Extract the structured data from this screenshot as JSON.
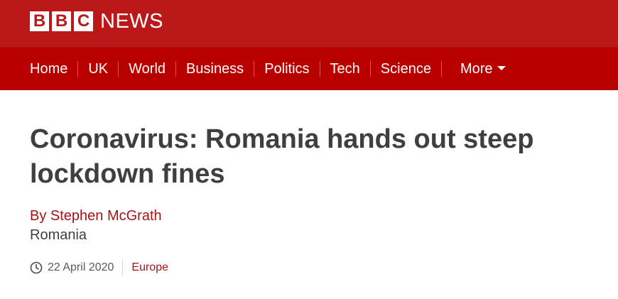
{
  "masthead": {
    "logo_letters": [
      "B",
      "B",
      "C"
    ],
    "logo_suffix": "NEWS",
    "brand_color": "#bb1919"
  },
  "nav": {
    "items": [
      {
        "label": "Home"
      },
      {
        "label": "UK"
      },
      {
        "label": "World"
      },
      {
        "label": "Business"
      },
      {
        "label": "Politics"
      },
      {
        "label": "Tech"
      },
      {
        "label": "Science"
      }
    ],
    "more_label": "More",
    "more_icon": "chevron-down-icon"
  },
  "article": {
    "headline": "Coronavirus: Romania hands out steep lockdown fines",
    "byline": "By Stephen McGrath",
    "byline_location": "Romania",
    "date": "22 April 2020",
    "date_icon": "clock-icon",
    "section": "Europe"
  }
}
